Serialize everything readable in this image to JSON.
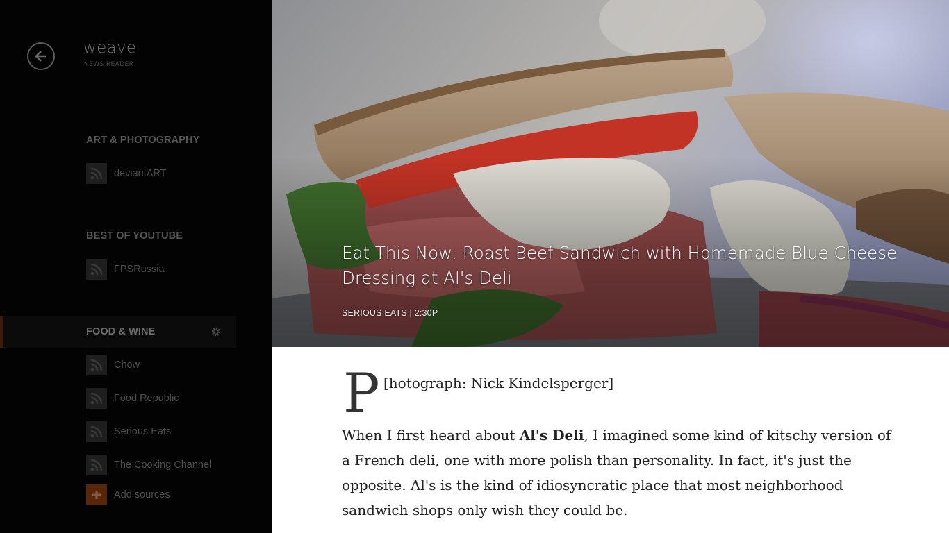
{
  "app": {
    "title": "weave",
    "subtitle": "NEWS READER"
  },
  "sidebar": {
    "categories": [
      {
        "name": "ART & PHOTOGRAPHY",
        "feeds": [
          "deviantART"
        ]
      },
      {
        "name": "BEST OF YOUTUBE",
        "feeds": [
          "FPSRussia"
        ]
      },
      {
        "name": "FOOD & WINE",
        "feeds": [
          "Chow",
          "Food Republic",
          "Serious Eats",
          "The Cooking Channel"
        ]
      }
    ],
    "add_sources": "Add sources"
  },
  "icons": {
    "back": "back-arrow-icon",
    "feed": "rss-icon",
    "settings": "gear-icon",
    "add": "plus-icon"
  },
  "colors": {
    "accent": "#c1520f",
    "sidebar_bg": "#030303",
    "article_bg": "#ffffff"
  },
  "article": {
    "headline": "Eat This Now: Roast Beef Sandwich with Homemade Blue Cheese Dressing at Al's Deli",
    "source": "SERIOUS EATS",
    "separator": "|",
    "time": "2:30P",
    "dropcap": "P",
    "caption": "[hotograph: Nick Kindelsperger]",
    "para_before": "When I first heard about ",
    "para_bold": "Al's Deli",
    "para_after": ", I imagined some kind of kitschy version of a French deli, one with more polish than personality. In fact, it's just the opposite. Al's is the kind of idiosyncratic place that most neighborhood sandwich shops only wish they could be."
  }
}
